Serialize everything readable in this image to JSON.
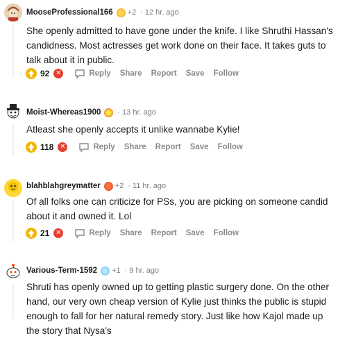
{
  "comments": [
    {
      "username": "MooseProfessional166",
      "karma": "+2",
      "time": "12 hr. ago",
      "body": "She openly admitted to have gone under the knife. I like Shruthi Hassan's candidness. Most actresses get work done on their face. It takes guts to talk about it in public.",
      "score": "92",
      "award_icon": "sun-award-icon"
    },
    {
      "username": "Moist-Whereas1900",
      "karma": "",
      "time": "13 hr. ago",
      "body": "Atleast she openly accepts it unlike wannabe Kylie!",
      "score": "118",
      "award_icon": "fire-award-icon"
    },
    {
      "username": "blahblahgreymatter",
      "karma": "+2",
      "time": "11 hr. ago",
      "body": "Of all folks one can criticize for PSs, you are picking on someone candid about it and owned it. Lol",
      "score": "21",
      "award_icon": "wholesome-award-icon"
    },
    {
      "username": "Various-Term-1592",
      "karma": "+1",
      "time": "9 hr. ago",
      "body": "Shruti has openly owned up to getting plastic surgery done. On the other hand, our very own cheap version of Kylie just thinks the public is stupid enough to fall for her natural remedy story. Just like how Kajol made up the story that Nysa's",
      "score": "",
      "award_icon": "sparkle-award-icon"
    }
  ],
  "actions": {
    "reply": "Reply",
    "share": "Share",
    "report": "Report",
    "save": "Save",
    "follow": "Follow"
  },
  "separator": "·",
  "colors": {
    "upvote": "#f4b400",
    "downvote": "#e53e30",
    "meta": "#7c7c7c",
    "action": "#878a8c"
  }
}
